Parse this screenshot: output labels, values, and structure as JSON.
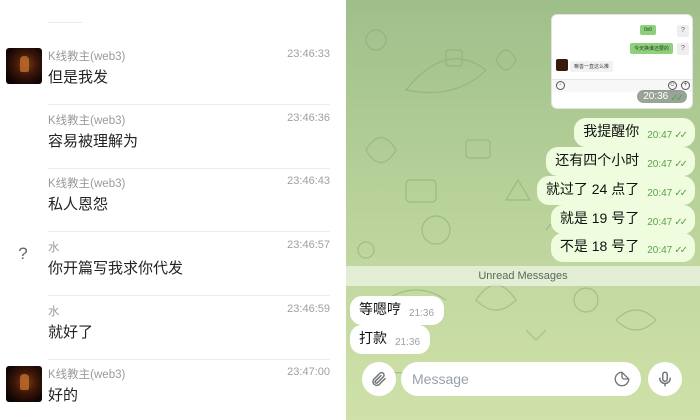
{
  "left_panel": {
    "messages": [
      {
        "sender": "K线教主(web3)",
        "time": "23:46:33",
        "text": "但是我发",
        "avatar": "photo-avatar"
      },
      {
        "sender": "K线教主(web3)",
        "time": "23:46:36",
        "text": "容易被理解为",
        "avatar": "none"
      },
      {
        "sender": "K线教主(web3)",
        "time": "23:46:43",
        "text": "私人恩怨",
        "avatar": "none"
      },
      {
        "sender": "水",
        "time": "23:46:57",
        "text": "你开篇写我求你代发",
        "avatar": "question-mark-icon"
      },
      {
        "sender": "水",
        "time": "23:46:59",
        "text": "就好了",
        "avatar": "none"
      },
      {
        "sender": "K线教主(web3)",
        "time": "23:47:00",
        "text": "好的",
        "avatar": "photo-avatar"
      }
    ]
  },
  "right_panel": {
    "screenshot_bubble": {
      "chip1": "0x0",
      "chip2": "今天换谁还要的",
      "question": "?",
      "incoming": "嘛善一直这么推",
      "time": "20:36"
    },
    "outgoing": [
      {
        "text": "我提醒你",
        "time": "20:47"
      },
      {
        "text": "还有四个小时",
        "time": "20:47"
      },
      {
        "text": "就过了 24 点了",
        "time": "20:47"
      },
      {
        "text": "就是 19 号了",
        "time": "20:47"
      },
      {
        "text": "不是 18 号了",
        "time": "20:47"
      }
    ],
    "unread_label": "Unread Messages",
    "incoming": [
      {
        "text": "等嗯哼",
        "time": "21:36"
      },
      {
        "text": "打款",
        "time": "21:36"
      }
    ],
    "composer": {
      "placeholder": "Message",
      "attach_icon": "paperclip-icon",
      "emoji_icon": "sticker-icon",
      "mic_icon": "microphone-icon"
    },
    "colors": {
      "wallpaper": "#b1cd95",
      "outgoing_bubble": "#effdde",
      "incoming_bubble": "#ffffff",
      "check": "#5aa24e"
    }
  }
}
